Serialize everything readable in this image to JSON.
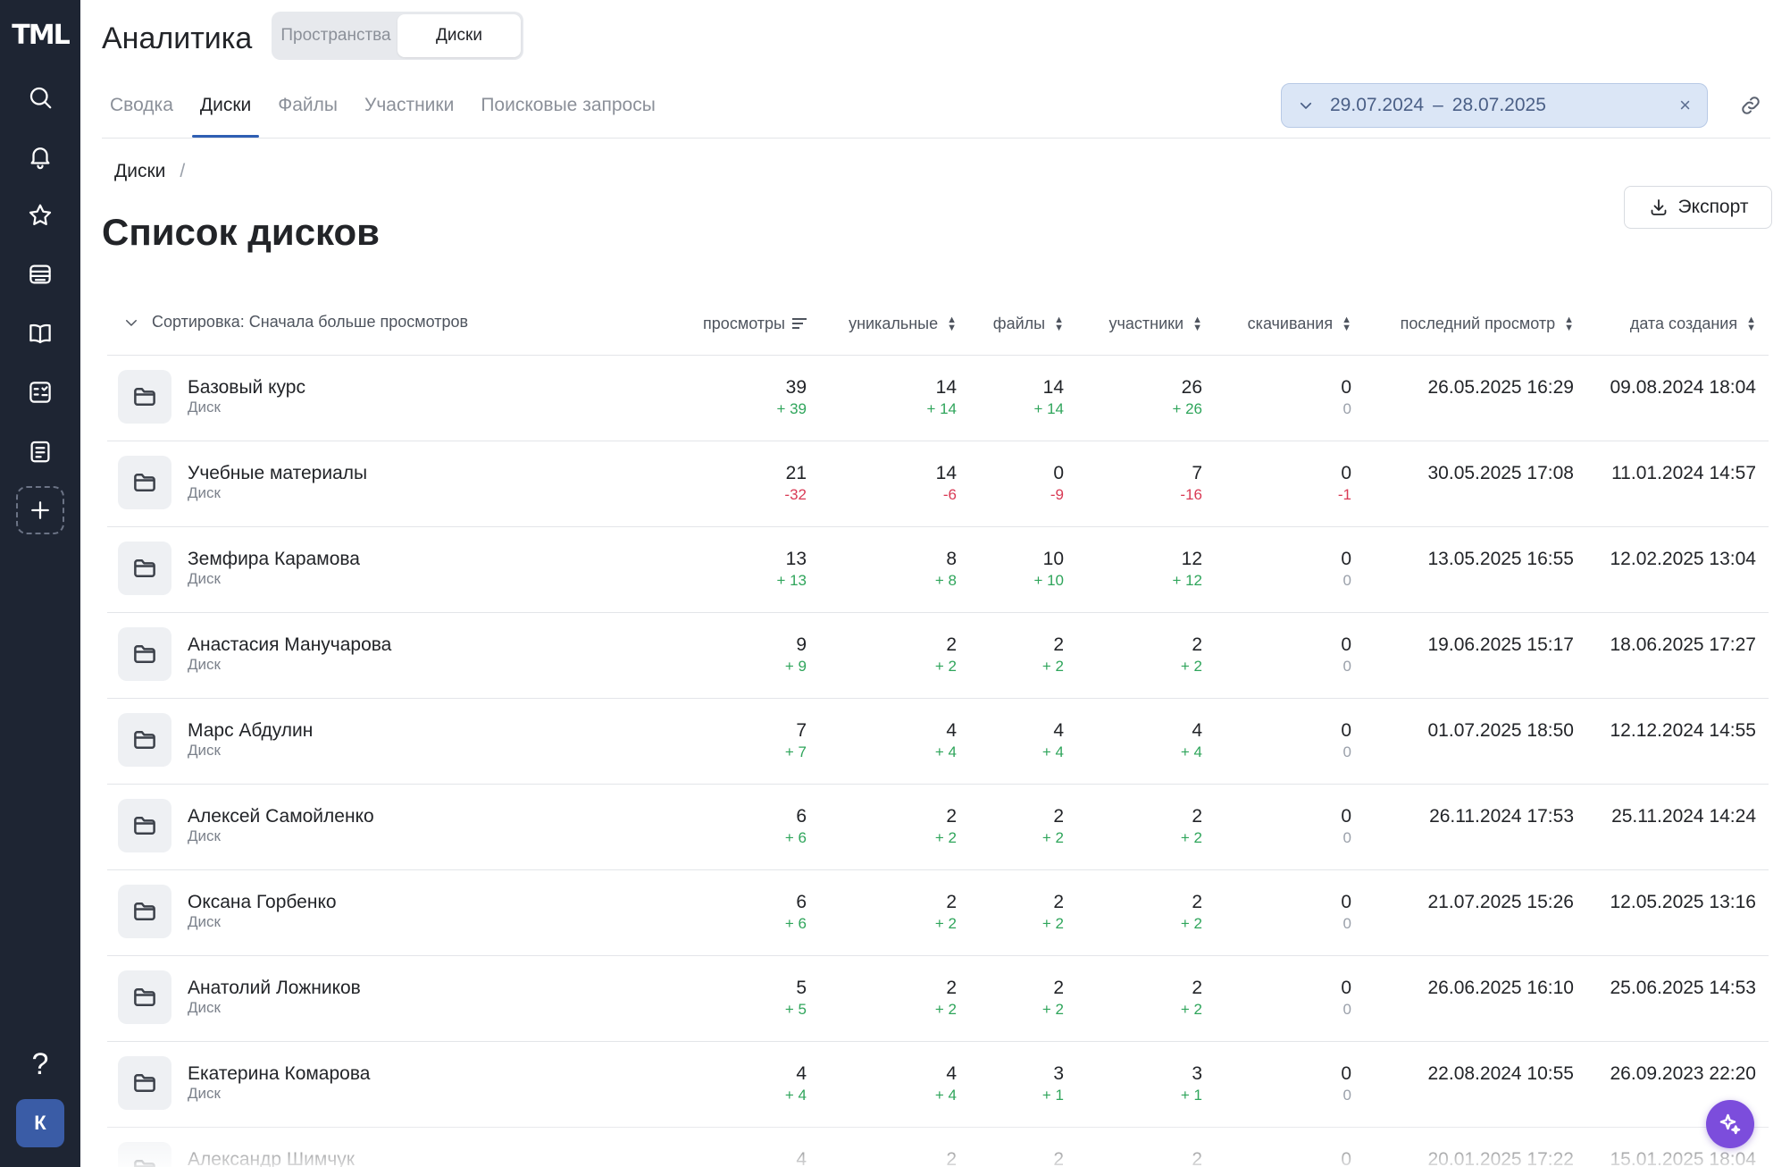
{
  "app": {
    "logo": "TML"
  },
  "sidebar": {
    "items": [
      {
        "name": "search-icon"
      },
      {
        "name": "bell-icon"
      },
      {
        "name": "star-icon"
      },
      {
        "name": "inbox-icon"
      },
      {
        "name": "book-icon"
      },
      {
        "name": "quiz-icon"
      },
      {
        "name": "clipboard-icon"
      },
      {
        "name": "plus-icon"
      }
    ],
    "help": "?",
    "avatar": "К"
  },
  "header": {
    "title": "Аналитика",
    "segments": [
      {
        "label": "Пространства",
        "active": false
      },
      {
        "label": "Диски",
        "active": true
      }
    ],
    "tabs": [
      {
        "label": "Сводка",
        "active": false
      },
      {
        "label": "Диски",
        "active": true
      },
      {
        "label": "Файлы",
        "active": false
      },
      {
        "label": "Участники",
        "active": false
      },
      {
        "label": "Поисковые запросы",
        "active": false
      }
    ],
    "date_from": "29.07.2024",
    "date_sep": "–",
    "date_to": "28.07.2025",
    "clear": "×"
  },
  "content": {
    "breadcrumb": "Диски",
    "breadcrumb_sep": "/",
    "title": "Список дисков",
    "export_label": "Экспорт",
    "sort_label": "Сортировка: Сначала больше просмотров"
  },
  "table": {
    "columns": {
      "views": "просмотры",
      "unique": "уникальные",
      "files": "файлы",
      "members": "участники",
      "downloads": "скачивания",
      "last_view": "последний просмотр",
      "created": "дата создания"
    },
    "rows": [
      {
        "name": "Базовый курс",
        "type": "Диск",
        "views": "39",
        "views_d": "+ 39",
        "uniq": "14",
        "uniq_d": "+ 14",
        "files": "14",
        "files_d": "+ 14",
        "mem": "26",
        "mem_d": "+ 26",
        "dl": "0",
        "dl_d": "0",
        "last": "26.05.2025 16:29",
        "created": "09.08.2024 18:04"
      },
      {
        "name": "Учебные материалы",
        "type": "Диск",
        "views": "21",
        "views_d": "-32",
        "uniq": "14",
        "uniq_d": "-6",
        "files": "0",
        "files_d": "-9",
        "mem": "7",
        "mem_d": "-16",
        "dl": "0",
        "dl_d": "-1",
        "last": "30.05.2025 17:08",
        "created": "11.01.2024 14:57"
      },
      {
        "name": "Земфира Карамова",
        "type": "Диск",
        "views": "13",
        "views_d": "+ 13",
        "uniq": "8",
        "uniq_d": "+ 8",
        "files": "10",
        "files_d": "+ 10",
        "mem": "12",
        "mem_d": "+ 12",
        "dl": "0",
        "dl_d": "0",
        "last": "13.05.2025 16:55",
        "created": "12.02.2025 13:04"
      },
      {
        "name": "Анастасия Манучарова",
        "type": "Диск",
        "views": "9",
        "views_d": "+ 9",
        "uniq": "2",
        "uniq_d": "+ 2",
        "files": "2",
        "files_d": "+ 2",
        "mem": "2",
        "mem_d": "+ 2",
        "dl": "0",
        "dl_d": "0",
        "last": "19.06.2025 15:17",
        "created": "18.06.2025 17:27"
      },
      {
        "name": "Марс Абдулин",
        "type": "Диск",
        "views": "7",
        "views_d": "+ 7",
        "uniq": "4",
        "uniq_d": "+ 4",
        "files": "4",
        "files_d": "+ 4",
        "mem": "4",
        "mem_d": "+ 4",
        "dl": "0",
        "dl_d": "0",
        "last": "01.07.2025 18:50",
        "created": "12.12.2024 14:55"
      },
      {
        "name": "Алексей Самойленко",
        "type": "Диск",
        "views": "6",
        "views_d": "+ 6",
        "uniq": "2",
        "uniq_d": "+ 2",
        "files": "2",
        "files_d": "+ 2",
        "mem": "2",
        "mem_d": "+ 2",
        "dl": "0",
        "dl_d": "0",
        "last": "26.11.2024 17:53",
        "created": "25.11.2024 14:24"
      },
      {
        "name": "Оксана Горбенко",
        "type": "Диск",
        "views": "6",
        "views_d": "+ 6",
        "uniq": "2",
        "uniq_d": "+ 2",
        "files": "2",
        "files_d": "+ 2",
        "mem": "2",
        "mem_d": "+ 2",
        "dl": "0",
        "dl_d": "0",
        "last": "21.07.2025 15:26",
        "created": "12.05.2025 13:16"
      },
      {
        "name": "Анатолий Ложников",
        "type": "Диск",
        "views": "5",
        "views_d": "+ 5",
        "uniq": "2",
        "uniq_d": "+ 2",
        "files": "2",
        "files_d": "+ 2",
        "mem": "2",
        "mem_d": "+ 2",
        "dl": "0",
        "dl_d": "0",
        "last": "26.06.2025 16:10",
        "created": "25.06.2025 14:53"
      },
      {
        "name": "Екатерина Комарова",
        "type": "Диск",
        "views": "4",
        "views_d": "+ 4",
        "uniq": "4",
        "uniq_d": "+ 4",
        "files": "3",
        "files_d": "+ 1",
        "mem": "3",
        "mem_d": "+ 1",
        "dl": "0",
        "dl_d": "0",
        "last": "22.08.2024 10:55",
        "created": "26.09.2023 22:20"
      },
      {
        "name": "Александр Шимчук",
        "type": "Диск",
        "views": "4",
        "views_d": "",
        "uniq": "2",
        "uniq_d": "",
        "files": "2",
        "files_d": "",
        "mem": "2",
        "mem_d": "",
        "dl": "0",
        "dl_d": "",
        "last": "20.01.2025 17:22",
        "created": "15.01.2025 18:04"
      }
    ]
  },
  "colors": {
    "sidebar": "#1e2533",
    "accent": "#2f5fb3",
    "positive": "#2fa55b",
    "negative": "#d93a55",
    "fab": "#7c4ddc"
  }
}
